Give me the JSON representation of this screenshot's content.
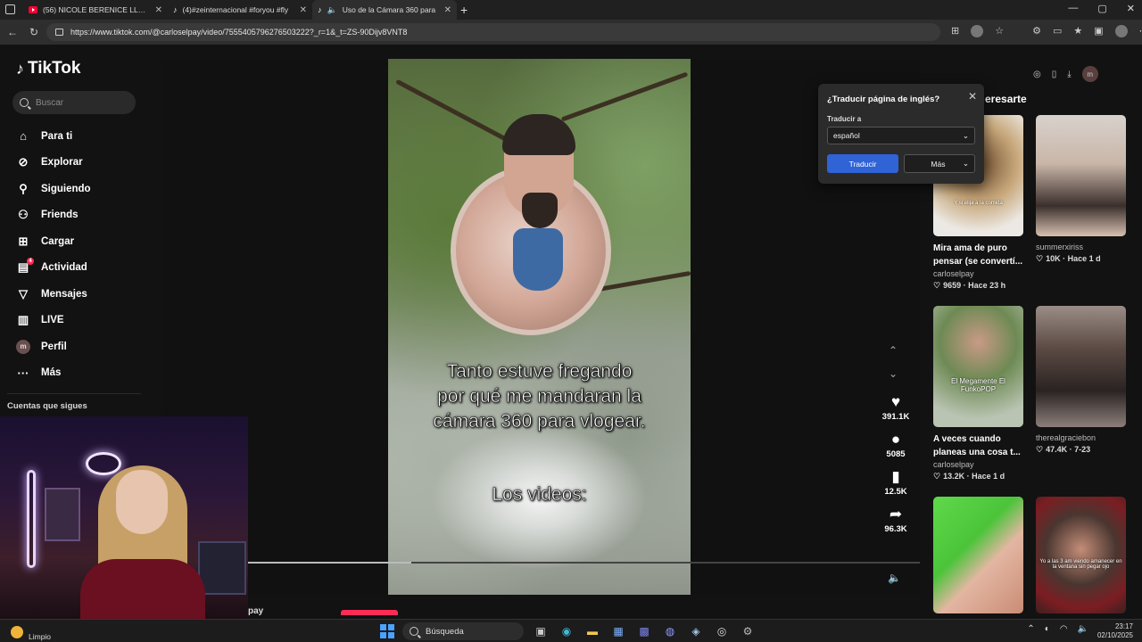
{
  "browser": {
    "tabs": [
      {
        "title": "(56) NICOLE BERENICE LLORA DE",
        "icon": "youtube-favicon"
      },
      {
        "title": "(4)#zeinternacional #foryou #fly",
        "icon": "tiktok-favicon"
      },
      {
        "title": "Uso de la Cámara 360 para",
        "icon": "tiktok-favicon",
        "active": true
      }
    ],
    "url": "https://www.tiktok.com/@carloselpay/video/7555405796276503222?_r=1&_t=ZS-90Dijv8VNT8"
  },
  "tiktok": {
    "logo": "TikTok",
    "search_placeholder": "Buscar",
    "menu": [
      {
        "label": "Para ti",
        "icon": "home-icon"
      },
      {
        "label": "Explorar",
        "icon": "compass-icon"
      },
      {
        "label": "Siguiendo",
        "icon": "user-follow-icon"
      },
      {
        "label": "Friends",
        "icon": "friends-icon"
      },
      {
        "label": "Cargar",
        "icon": "upload-icon"
      },
      {
        "label": "Actividad",
        "icon": "activity-icon",
        "badge": "4"
      },
      {
        "label": "Mensajes",
        "icon": "send-icon"
      },
      {
        "label": "LIVE",
        "icon": "live-icon"
      },
      {
        "label": "Perfil",
        "icon": "avatar"
      },
      {
        "label": "Más",
        "icon": "more-icon"
      }
    ],
    "profile_initial": "m",
    "following_heading": "Cuentas que sigues",
    "video": {
      "caption_main": "Tanto estuve fregando\npor qué me mandaran la\ncámara 360 para vlogear.",
      "caption_sub": "Los videos:",
      "progress": 0.33,
      "author_peek": "pay"
    },
    "actions": [
      {
        "icon": "heart-icon",
        "count": "391.1K"
      },
      {
        "icon": "comment-icon",
        "count": "5085"
      },
      {
        "icon": "bookmark-icon",
        "count": "12.5K"
      },
      {
        "icon": "share-icon",
        "count": "96.3K"
      }
    ],
    "right_heading": "eresarte",
    "recommendations": [
      {
        "title": "Mira ama de puro pensar (se convertí...",
        "author": "carloselpay",
        "likes": "9659",
        "age": "Hace 23 h",
        "thumb_text": "Y si elija a la comida"
      },
      {
        "title": "",
        "author": "summerxiriss",
        "likes": "10K",
        "age": "Hace 1 d",
        "thumb_text": ""
      },
      {
        "title": "A veces cuando planeas una cosa t...",
        "author": "carloselpay",
        "likes": "13.2K",
        "age": "Hace 1 d",
        "thumb_text": "El Megamente El FunkoPOP"
      },
      {
        "title": "",
        "author": "therealgraciebon",
        "likes": "47.4K",
        "age": "7-23",
        "thumb_text": ""
      },
      {
        "title": "",
        "author": "",
        "likes": "",
        "age": "",
        "thumb_text": ""
      },
      {
        "title": "",
        "author": "",
        "likes": "",
        "age": "",
        "thumb_text": "Yo a las 3 am viendo amanecer en la ventana sin pegar ojo"
      }
    ]
  },
  "translate_popup": {
    "title": "¿Traducir página de inglés?",
    "label": "Traducir a",
    "selected": "español",
    "translate_btn": "Traducir",
    "more_btn": "Más"
  },
  "taskbar": {
    "weather": "Limpio",
    "search_label": "Búsqueda",
    "time": "23:17",
    "date": "02/10/2025"
  },
  "colors": {
    "accent": "#fe2c55",
    "translate_blue": "#2f63d6",
    "page_bg": "#121212"
  }
}
